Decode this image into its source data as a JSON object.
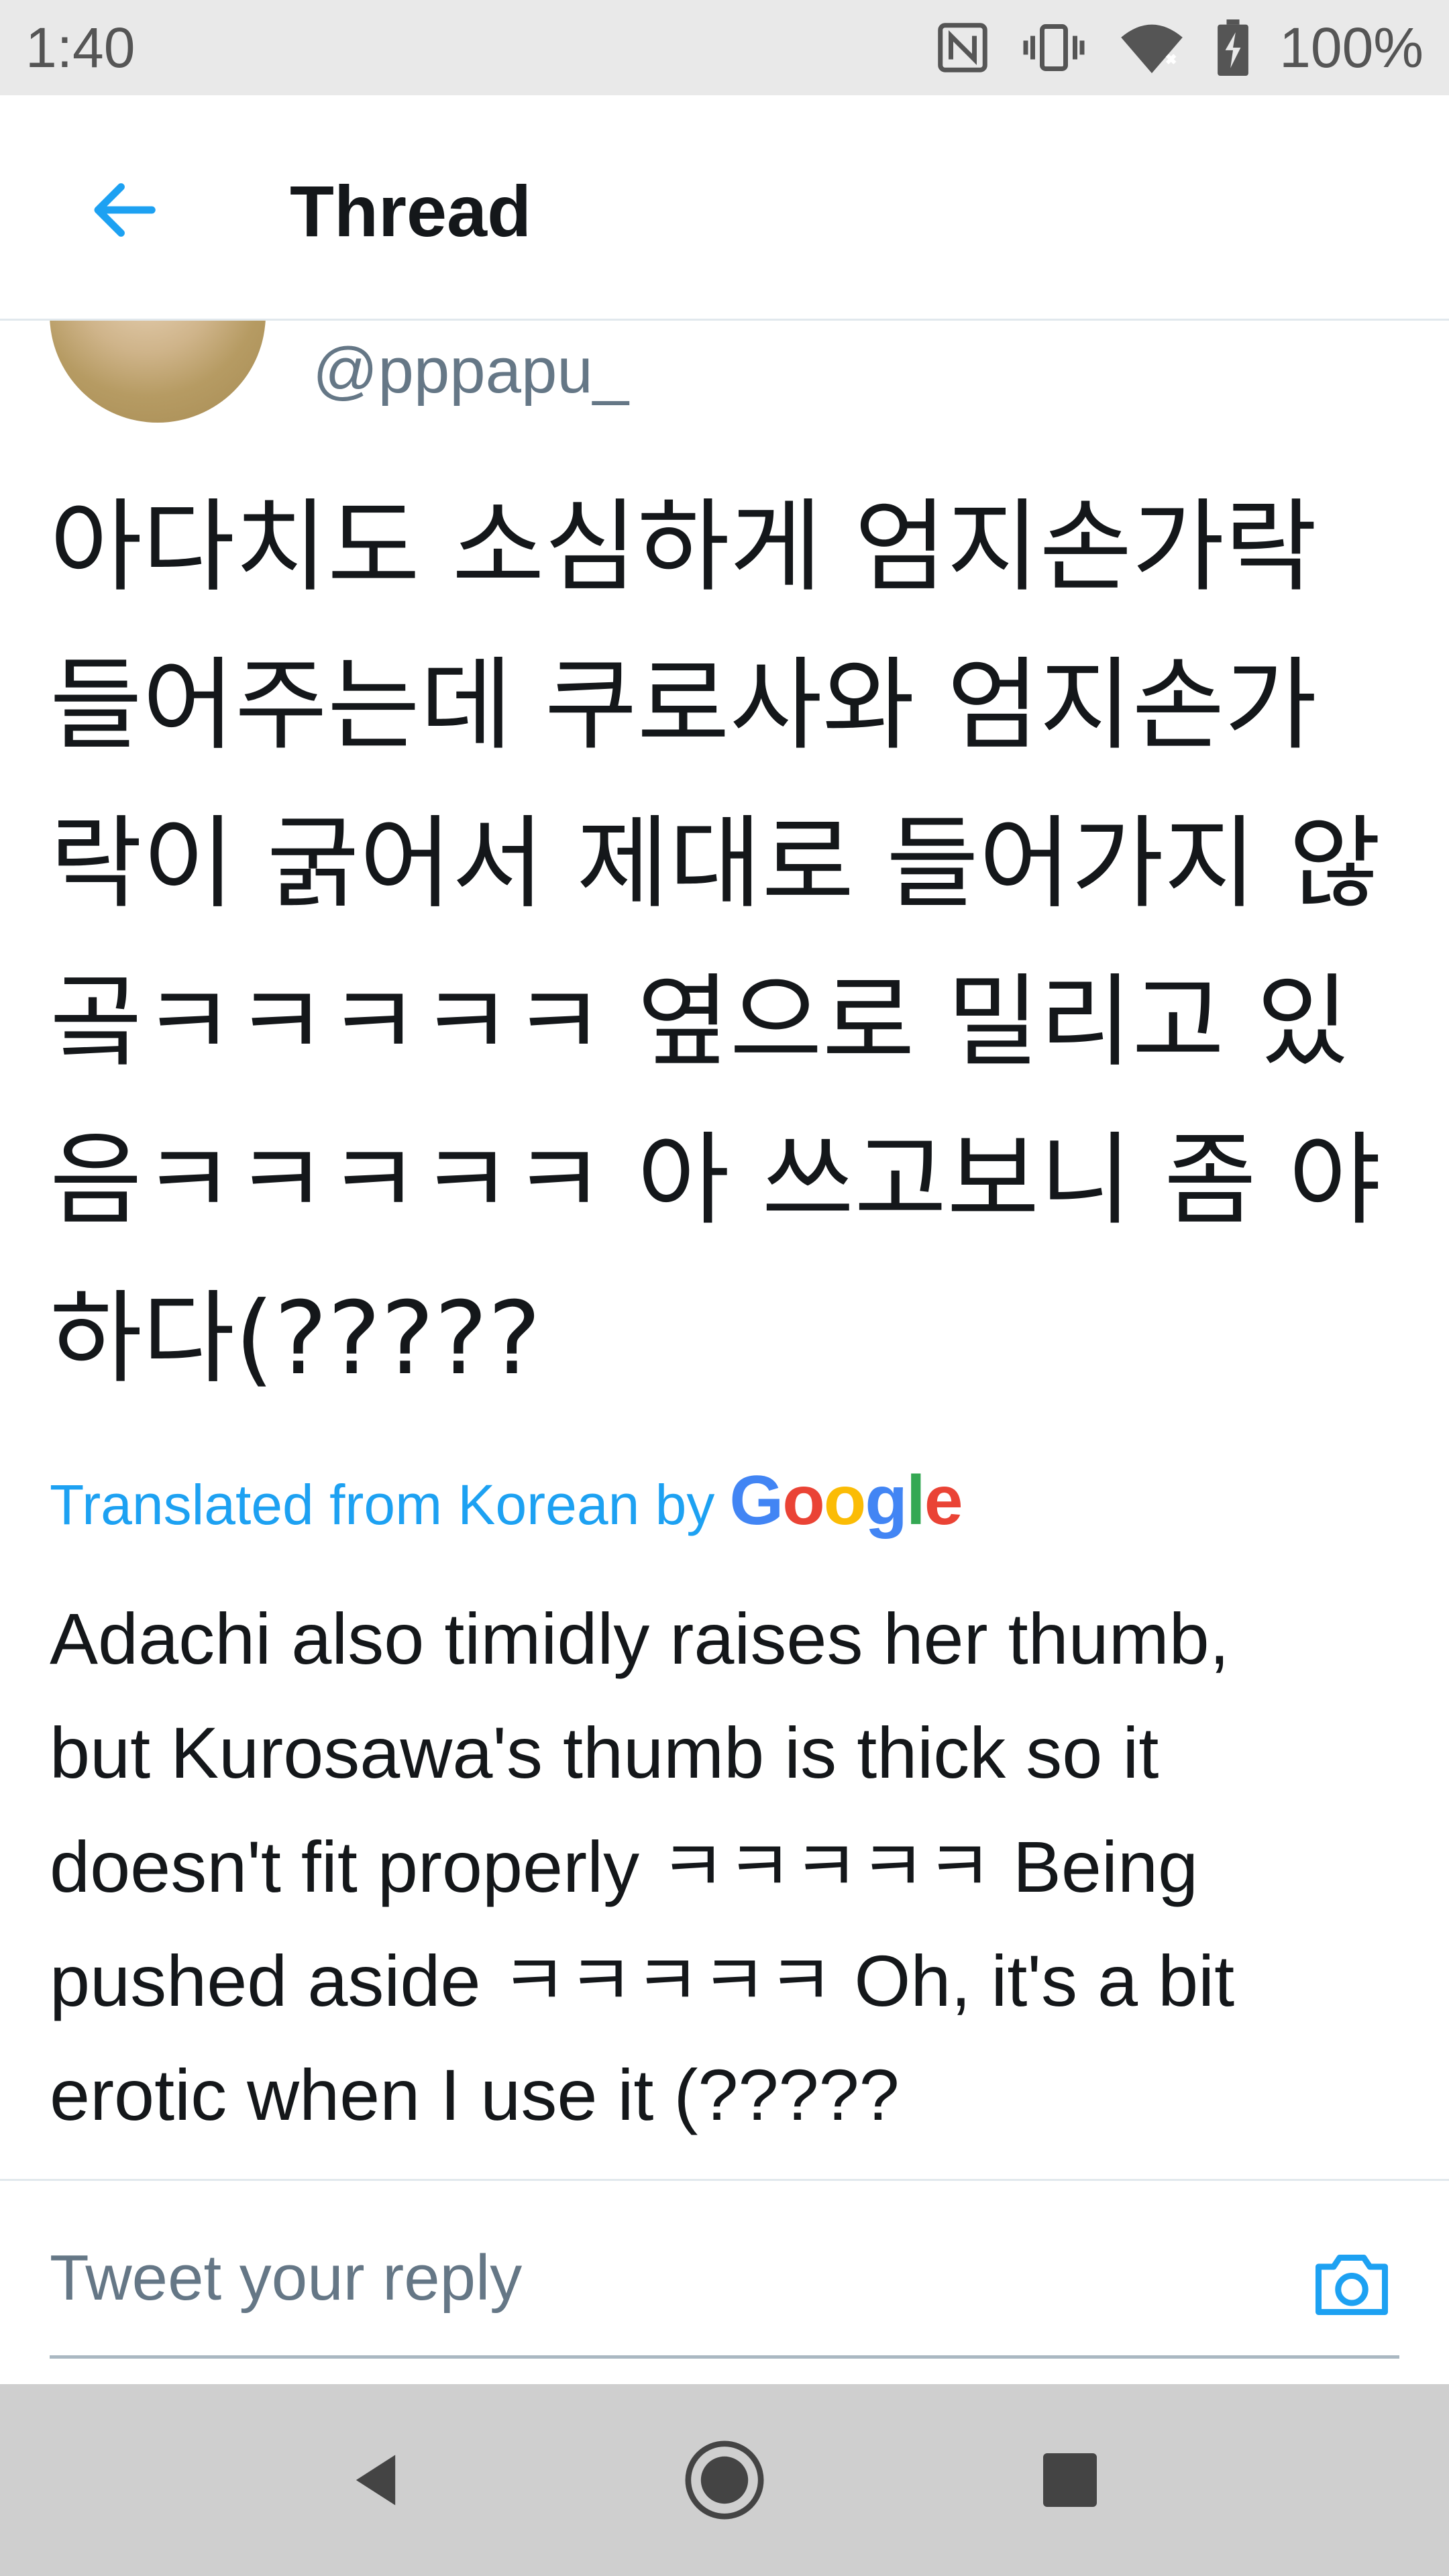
{
  "status_bar": {
    "time": "1:40",
    "battery": "100%",
    "icons": [
      "nfc-icon",
      "vibrate-icon",
      "wifi-icon",
      "battery-charging-icon"
    ]
  },
  "header": {
    "title": "Thread",
    "back_icon": "arrow-left-icon"
  },
  "tweet": {
    "handle": "@pppapu_",
    "text": "아다치도 소심하게 엄지손가락\n들어주는데 쿠로사와 엄지손가\n락이 굵어서 제대로 들어가지 않\n곸ㅋㅋㅋㅋㅋ 옆으로 밀리고 있\n음ㅋㅋㅋㅋㅋ 아 쓰고보니 좀 야\n하다(?????",
    "translation_label": "Translated from Korean by",
    "translation_provider": "Google",
    "translated_text": "Adachi also timidly raises her thumb,\nbut Kurosawa's thumb is thick so it\ndoesn't fit properly ㅋㅋㅋㅋㅋ Being\npushed aside ㅋㅋㅋㅋㅋ Oh, it's a bit\nerotic when I use it (?????"
  },
  "reply": {
    "placeholder": "Tweet your reply",
    "camera_icon": "camera-icon"
  },
  "nav_bar": {
    "icons": [
      "back-triangle-icon",
      "home-circle-icon",
      "recents-square-icon"
    ]
  },
  "colors": {
    "accent": "#1da1f2",
    "secondary_text": "#657786",
    "status_bar_bg": "#e9e9e9",
    "nav_bar_bg": "#cfcfcf",
    "google_blue": "#4285f4",
    "google_red": "#ea4335",
    "google_yellow": "#fbbc05",
    "google_green": "#34a853"
  }
}
